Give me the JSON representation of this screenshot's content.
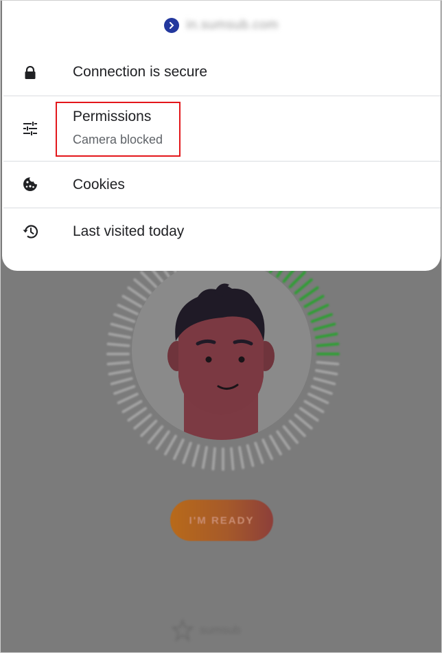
{
  "popup": {
    "site_url": "in.sumsub.com",
    "rows": [
      {
        "title": "Connection is secure",
        "icon": "lock-icon"
      },
      {
        "title": "Permissions",
        "subtitle": "Camera blocked",
        "icon": "tune-sliders-icon"
      },
      {
        "title": "Cookies",
        "icon": "cookie-icon"
      },
      {
        "title": "Last visited today",
        "icon": "history-icon"
      }
    ]
  },
  "background_page": {
    "ready_button_label": "I'M READY",
    "brand_name": "sumsub"
  },
  "colors": {
    "highlight": "#e3161a",
    "favicon": "#23389e",
    "overlay": "#7b7b7b",
    "progress_green": "#2f9e34"
  }
}
